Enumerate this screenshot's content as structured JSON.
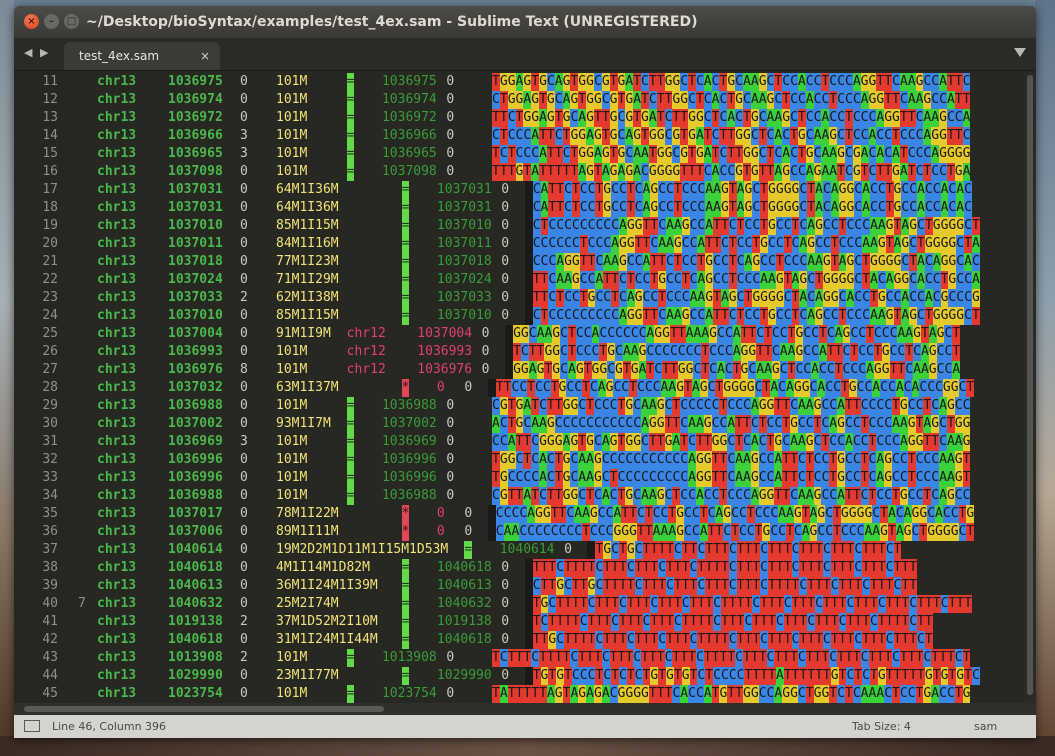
{
  "window": {
    "title": "~/Desktop/bioSyntax/examples/test_4ex.sam - Sublime Text (UNREGISTERED)",
    "close_glyph": "×",
    "min_glyph": "–",
    "max_glyph": "□"
  },
  "tabs": {
    "nav": "◀ ▶",
    "items": [
      {
        "label": "test_4ex.sam",
        "close": "×"
      }
    ]
  },
  "status": {
    "position": "Line 46, Column 396",
    "tab_size": "Tab Size: 4",
    "syntax": "sam"
  },
  "colors": {
    "A": "#3ad13a",
    "C": "#3a86e6",
    "G": "#e6c92a",
    "T": "#e3392e",
    "eq": "#64d94a",
    "star": "#e0475a"
  },
  "editor": {
    "lines": [
      {
        "n": "11",
        "fold": "",
        "chr": "chr13",
        "pos": "1036975",
        "mapq": "0",
        "cigar": "101M",
        "rnext": "=",
        "pnext": "1036975",
        "tlen": "0",
        "seq": "TGGAGTGCAGTGGCGTGATCTTGGCTCACTGCAAGCTCCACCTCCCAGGTTCAAGCCATTC"
      },
      {
        "n": "12",
        "fold": "",
        "chr": "chr13",
        "pos": "1036974",
        "mapq": "0",
        "cigar": "101M",
        "rnext": "=",
        "pnext": "1036974",
        "tlen": "0",
        "seq": "CTGGAGTGCAGTGGCGTGATCTTGGCTCACTGCAAGCTCCACCTCCCAGGTTCAAGCCATT"
      },
      {
        "n": "13",
        "fold": "",
        "chr": "chr13",
        "pos": "1036972",
        "mapq": "0",
        "cigar": "101M",
        "rnext": "=",
        "pnext": "1036972",
        "tlen": "0",
        "seq": "TTCTGGAGTGCAGTTGCGTGATCTTGGCTCACTGCAAGCTCCACCTCCCAGGTTCAAGCCA"
      },
      {
        "n": "14",
        "fold": "",
        "chr": "chr13",
        "pos": "1036966",
        "mapq": "3",
        "cigar": "101M",
        "rnext": "=",
        "pnext": "1036966",
        "tlen": "0",
        "seq": "CTCCCATTCTGGAGTGCAGTGGCGTGATCTTGGCTCACTGCAAGCTCCACCTCCCAGGTTC"
      },
      {
        "n": "15",
        "fold": "",
        "chr": "chr13",
        "pos": "1036965",
        "mapq": "3",
        "cigar": "101M",
        "rnext": "=",
        "pnext": "1036965",
        "tlen": "0",
        "seq": "TCTCCCATTCTGGAGTGCAATGGCGTGATCTTGGCTCACTGCAAGCGACACATCCCAGGGG"
      },
      {
        "n": "16",
        "fold": "",
        "chr": "chr13",
        "pos": "1037098",
        "mapq": "0",
        "cigar": "101M",
        "rnext": "=",
        "pnext": "1037098",
        "tlen": "0",
        "seq": "TTTGTATTTTTAGTAGAGACGGGGTTTCACCGTGTTAGCCAGAATCGTCTTGATCTCCTGA"
      },
      {
        "n": "17",
        "fold": "",
        "chr": "chr13",
        "pos": "1037031",
        "mapq": "0",
        "cigar": "64M1I36M",
        "rnext": "=",
        "pnext": "1037031",
        "tlen": "0",
        "seq": "CATTCTCCTGCCTCAGCCTCCCAAGTAGCTGGGGCTACAGGCACCTGCCACCACAC"
      },
      {
        "n": "18",
        "fold": "",
        "chr": "chr13",
        "pos": "1037031",
        "mapq": "0",
        "cigar": "64M1I36M",
        "rnext": "=",
        "pnext": "1037031",
        "tlen": "0",
        "seq": "CATTCTCCTGCCTCAGCCTCCCAAGTAGCTGGGGCTACAGGCACCTGCCACCACAC"
      },
      {
        "n": "19",
        "fold": "",
        "chr": "chr13",
        "pos": "1037010",
        "mapq": "0",
        "cigar": "85M1I15M",
        "rnext": "=",
        "pnext": "1037010",
        "tlen": "0",
        "seq": "CTCCCCCCCCCAGGTTCAAGCCATTCTCCTGCCTCAGCCTCCCAAGTAGCTGGGGCT"
      },
      {
        "n": "20",
        "fold": "",
        "chr": "chr13",
        "pos": "1037011",
        "mapq": "0",
        "cigar": "84M1I16M",
        "rnext": "=",
        "pnext": "1037011",
        "tlen": "0",
        "seq": "CCCCCCTCCCAGGTTCAAGCCATTCTCCTGCCTCAGCCTCCCAAGTAGCTGGGGCTA"
      },
      {
        "n": "21",
        "fold": "",
        "chr": "chr13",
        "pos": "1037018",
        "mapq": "0",
        "cigar": "77M1I23M",
        "rnext": "=",
        "pnext": "1037018",
        "tlen": "0",
        "seq": "CCCAGGTTCAAGCCATTCTCCTGCCTCAGCCTCCCAAGTAGCTGGGGCTACAGGCAC"
      },
      {
        "n": "22",
        "fold": "",
        "chr": "chr13",
        "pos": "1037024",
        "mapq": "0",
        "cigar": "71M1I29M",
        "rnext": "=",
        "pnext": "1037024",
        "tlen": "0",
        "seq": "TTCAAGCCATTCTCCTGCCTCAGCCTCCCAAGTAGCTGGGGCTACAGGCACCTGCCA"
      },
      {
        "n": "23",
        "fold": "",
        "chr": "chr13",
        "pos": "1037033",
        "mapq": "2",
        "cigar": "62M1I38M",
        "rnext": "=",
        "pnext": "1037033",
        "tlen": "0",
        "seq": "TTCTCCTGCCTCAGCCTCCCAAGTAGCTGGGGCTACAGGCACCTGCCACCACGCCCG"
      },
      {
        "n": "24",
        "fold": "",
        "chr": "chr13",
        "pos": "1037010",
        "mapq": "0",
        "cigar": "85M1I15M",
        "rnext": "=",
        "pnext": "1037010",
        "tlen": "0",
        "seq": "CTCCCCCCCCCAGGTTCAAGCCATTCTCCTGCCTCAGCCTCCCAAGTAGCTGGGGCT"
      },
      {
        "n": "25",
        "fold": "",
        "chr": "chr13",
        "pos": "1037004",
        "mapq": "0",
        "cigar": "91M1I9M",
        "rnext": "chr12",
        "pnext": "1037004",
        "tlen": "0",
        "seq": "GGCAAGCTCCACCCCCCAGGTTAAAGCCATTCTCCTGCCTCAGCCTCCCAAGTAGCT"
      },
      {
        "n": "26",
        "fold": "",
        "chr": "chr13",
        "pos": "1036993",
        "mapq": "0",
        "cigar": "101M",
        "rnext": "chr12",
        "pnext": "1036993",
        "tlen": "0",
        "seq": "TCTTGGCTCCCTGCAAGCCCCCCCTCCCAGGTTCAAGCCATTCTCCTGCCTCAGCCT"
      },
      {
        "n": "27",
        "fold": "",
        "chr": "chr13",
        "pos": "1036976",
        "mapq": "8",
        "cigar": "101M",
        "rnext": "chr12",
        "pnext": "1036976",
        "tlen": "0",
        "seq": "GGAGTGCAGTGGCGTGATCTTGGCTCACTGCAAGCTCCACCTCCCAGGTTCAAGCCA"
      },
      {
        "n": "28",
        "fold": "",
        "chr": "chr13",
        "pos": "1037032",
        "mapq": "0",
        "cigar": "63M1I37M",
        "rnext": "*",
        "pnext": "0",
        "tlen": "0",
        "seq": "TTCCTCCTGCCTCAGCCTCCCAAGTAGCTGGGGCTACAGGCACCTGCCACCACACCCGGCT"
      },
      {
        "n": "29",
        "fold": "",
        "chr": "chr13",
        "pos": "1036988",
        "mapq": "0",
        "cigar": "101M",
        "rnext": "=",
        "pnext": "1036988",
        "tlen": "0",
        "seq": "CGTGATCTTGGCTCCCTGCAAGCTCCCCCTCCCAGGTTCAAGCCATTCCCCTGCCTCAGCC"
      },
      {
        "n": "30",
        "fold": "",
        "chr": "chr13",
        "pos": "1037002",
        "mapq": "0",
        "cigar": "93M1I7M",
        "rnext": "=",
        "pnext": "1037002",
        "tlen": "0",
        "seq": "ACTGCAAGCCCCCCCCCCCAGGTTCAAGCCATTCTCCTGCCTCAGCCTCCCAAGTAGCTGG"
      },
      {
        "n": "31",
        "fold": "",
        "chr": "chr13",
        "pos": "1036969",
        "mapq": "3",
        "cigar": "101M",
        "rnext": "=",
        "pnext": "1036969",
        "tlen": "0",
        "seq": "CCATTCGGGAGTGCAGTGGCTTGATCTTGGCTCACTGCAAGCTCCACCTCCCAGGTTCAAG"
      },
      {
        "n": "32",
        "fold": "",
        "chr": "chr13",
        "pos": "1036996",
        "mapq": "0",
        "cigar": "101M",
        "rnext": "=",
        "pnext": "1036996",
        "tlen": "0",
        "seq": "TGGCTCACTGCAAGCCCCCCCCCCCAGGTTCAAGCCATTCTCCTGCCTCAGCCTCCCAAGT"
      },
      {
        "n": "33",
        "fold": "",
        "chr": "chr13",
        "pos": "1036996",
        "mapq": "0",
        "cigar": "101M",
        "rnext": "=",
        "pnext": "1036996",
        "tlen": "0",
        "seq": "TGCCCCACTGCAAGCTCCCCCCCCCAGGTTCAAGCCATTCTCCTGCCTCAGCCTCCCAAGT"
      },
      {
        "n": "34",
        "fold": "",
        "chr": "chr13",
        "pos": "1036988",
        "mapq": "0",
        "cigar": "101M",
        "rnext": "=",
        "pnext": "1036988",
        "tlen": "0",
        "seq": "CGTTATCTTGGCTCACTGCAAGCTCCACCTCCCAGGTTCAAGCCATTCTCCTGCCTCAGCC"
      },
      {
        "n": "35",
        "fold": "",
        "chr": "chr13",
        "pos": "1037017",
        "mapq": "0",
        "cigar": "78M1I22M",
        "rnext": "*",
        "pnext": "0",
        "tlen": "0",
        "seq": "CCCCAGGTTCAAGCCATTCTCCTGCCTCAGCCTCCCAAGTAGCTGGGGCTACAGGCACCTG"
      },
      {
        "n": "36",
        "fold": "",
        "chr": "chr13",
        "pos": "1037006",
        "mapq": "0",
        "cigar": "89M1I11M",
        "rnext": "*",
        "pnext": "0",
        "tlen": "0",
        "seq": "CAACCCCCCCCTCCCGGGTTAAAGCCATTCTCCTGCCTCAGCCTCCCAAGTAGCTGGGGCT"
      },
      {
        "n": "37",
        "fold": "",
        "chr": "chr13",
        "pos": "1040614",
        "mapq": "0",
        "cigar": "19M2D2M1D11M1I15M1D53M",
        "rnext": "=",
        "pnext": "1040614",
        "tlen": "0",
        "seq": "TGCTGCTTTTCTTCTTTCTTTCTTTCTTTCTTTCTTTCT"
      },
      {
        "n": "38",
        "fold": "",
        "chr": "chr13",
        "pos": "1040618",
        "mapq": "0",
        "cigar": "4M1I14M1D82M",
        "rnext": "=",
        "pnext": "1040618",
        "tlen": "0",
        "seq": "TTTCTTTTCTTTCTTTCTTTCTTTTCTTTCTTTCTTTCTTTCTTTCTTT"
      },
      {
        "n": "39",
        "fold": "",
        "chr": "chr13",
        "pos": "1040613",
        "mapq": "0",
        "cigar": "36M1I24M1I39M",
        "rnext": "=",
        "pnext": "1040613",
        "tlen": "0",
        "seq": "CTTGCTTGCTTTTCTTTCTTTCTTTCTTTCTTTTCTTTCTTTCTTTCTT"
      },
      {
        "n": "40",
        "fold": "7",
        "chr": "chr13",
        "pos": "1040632",
        "mapq": "0",
        "cigar": "25M2I74M",
        "rnext": "=",
        "pnext": "1040632",
        "tlen": "0",
        "seq": "TGCTTTTCTTTCTTTCTTTCTTTCTTTTCTTTCTTTCTTTCTTTCTTTCTTTCTTT"
      },
      {
        "n": "41",
        "fold": "",
        "chr": "chr13",
        "pos": "1019138",
        "mapq": "2",
        "cigar": "37M1D52M2I10M",
        "rnext": "=",
        "pnext": "1019138",
        "tlen": "0",
        "seq": "TCTTTTCTTTCTTTCTTTCTTTTCTTTCTTTCTTTCTTTCTTTCTTTTCTT"
      },
      {
        "n": "42",
        "fold": "",
        "chr": "chr13",
        "pos": "1040618",
        "mapq": "0",
        "cigar": "31M1I24M1I44M",
        "rnext": "=",
        "pnext": "1040618",
        "tlen": "0",
        "seq": "TTGCTTTTCTTTCTTTCTTTCTTTTCTTTCTTTCTTTCTTTCTTTCTTTCT"
      },
      {
        "n": "43",
        "fold": "",
        "chr": "chr13",
        "pos": "1013908",
        "mapq": "2",
        "cigar": "101M",
        "rnext": "=",
        "pnext": "1013908",
        "tlen": "0",
        "seq": "TCTTTCTTTTCTTTCTTTCTTTCTTTCTTTTCTTTCTTTCTTTCTTTCTTTCTTTCTTTCT"
      },
      {
        "n": "44",
        "fold": "",
        "chr": "chr13",
        "pos": "1029990",
        "mapq": "0",
        "cigar": "23M1I77M",
        "rnext": "=",
        "pnext": "1029990",
        "tlen": "0",
        "seq": "TGTGTCCCTCTCTCTGTGTGTCTCCCCTTTTATTTTTTGTCTCTGTTTTTGTGTGTC"
      },
      {
        "n": "45",
        "fold": "",
        "chr": "chr13",
        "pos": "1023754",
        "mapq": "0",
        "cigar": "101M",
        "rnext": "=",
        "pnext": "1023754",
        "tlen": "0",
        "seq": "TATTTTTAGTAGAGACGGGGTTTCACCATGTTGGCCAGGCTGGTCTCAAACTCCTGACCTG"
      }
    ]
  }
}
